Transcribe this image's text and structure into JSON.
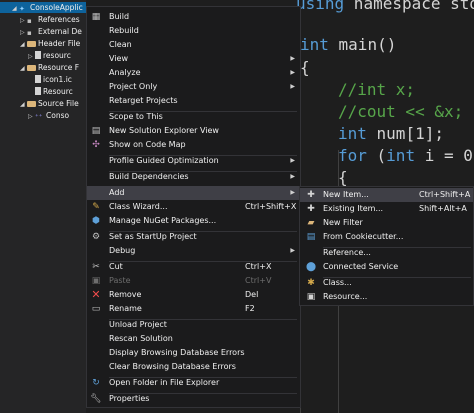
{
  "solution_explorer": {
    "items": [
      {
        "label": "ConsoleApplic",
        "icon": "project-icon",
        "arrow": "◢"
      },
      {
        "label": "References",
        "icon": "references-icon",
        "arrow": "▷"
      },
      {
        "label": "External De",
        "icon": "external-dependencies-icon",
        "arrow": "▷"
      },
      {
        "label": "Header File",
        "icon": "folder-icon",
        "arrow": "◢"
      },
      {
        "label": "resourc",
        "icon": "header-file-icon",
        "arrow": "▷"
      },
      {
        "label": "Resource F",
        "icon": "folder-icon",
        "arrow": "◢"
      },
      {
        "label": "icon1.ic",
        "icon": "icon-file-icon",
        "arrow": ""
      },
      {
        "label": "Resourc",
        "icon": "resource-file-icon",
        "arrow": ""
      },
      {
        "label": "Source File",
        "icon": "folder-icon",
        "arrow": "◢"
      },
      {
        "label": "Conso",
        "icon": "cpp-file-icon",
        "arrow": "▷"
      }
    ]
  },
  "code": {
    "line0": {
      "kw": "using",
      "rest": " namespace std"
    },
    "line1": {
      "kw": "int",
      "rest": " main()"
    },
    "line2": "{",
    "line3": "//int x;",
    "line4": "//cout << &x;",
    "line5": {
      "kw": "int",
      "rest": " num[1];"
    },
    "line6": {
      "kw": "for",
      "mid": " (",
      "kw2": "int",
      "rest": " i = 0"
    },
    "line7": "{"
  },
  "context_menu": {
    "items": [
      {
        "label": "Build",
        "shortcut": "",
        "icon": "build-icon",
        "arrow": false
      },
      {
        "label": "Rebuild",
        "shortcut": "",
        "icon": "",
        "arrow": false
      },
      {
        "label": "Clean",
        "shortcut": "",
        "icon": "",
        "arrow": false
      },
      {
        "label": "View",
        "shortcut": "",
        "icon": "",
        "arrow": true
      },
      {
        "label": "Analyze",
        "shortcut": "",
        "icon": "",
        "arrow": true
      },
      {
        "label": "Project Only",
        "shortcut": "",
        "icon": "",
        "arrow": true
      },
      {
        "label": "Retarget Projects",
        "shortcut": "",
        "icon": "",
        "arrow": false
      },
      {
        "label": "Scope to This",
        "shortcut": "",
        "icon": "",
        "arrow": false
      },
      {
        "label": "New Solution Explorer View",
        "shortcut": "",
        "icon": "solution-explorer-icon",
        "arrow": false
      },
      {
        "label": "Show on Code Map",
        "shortcut": "",
        "icon": "code-map-icon",
        "arrow": false
      },
      {
        "label": "Profile Guided Optimization",
        "shortcut": "",
        "icon": "",
        "arrow": true
      },
      {
        "label": "Build Dependencies",
        "shortcut": "",
        "icon": "",
        "arrow": true
      },
      {
        "label": "Add",
        "shortcut": "",
        "icon": "",
        "arrow": true
      },
      {
        "label": "Class Wizard...",
        "shortcut": "Ctrl+Shift+X",
        "icon": "class-wizard-icon",
        "arrow": false
      },
      {
        "label": "Manage NuGet Packages...",
        "shortcut": "",
        "icon": "nuget-icon",
        "arrow": false
      },
      {
        "label": "Set as StartUp Project",
        "shortcut": "",
        "icon": "gear-icon",
        "arrow": false
      },
      {
        "label": "Debug",
        "shortcut": "",
        "icon": "",
        "arrow": true
      },
      {
        "label": "Cut",
        "shortcut": "Ctrl+X",
        "icon": "cut-icon",
        "arrow": false
      },
      {
        "label": "Paste",
        "shortcut": "Ctrl+V",
        "icon": "paste-icon",
        "arrow": false,
        "disabled": true
      },
      {
        "label": "Remove",
        "shortcut": "Del",
        "icon": "remove-icon",
        "arrow": false
      },
      {
        "label": "Rename",
        "shortcut": "F2",
        "icon": "rename-icon",
        "arrow": false
      },
      {
        "label": "Unload Project",
        "shortcut": "",
        "icon": "",
        "arrow": false
      },
      {
        "label": "Rescan Solution",
        "shortcut": "",
        "icon": "",
        "arrow": false
      },
      {
        "label": "Display Browsing Database Errors",
        "shortcut": "",
        "icon": "",
        "arrow": false
      },
      {
        "label": "Clear Browsing Database Errors",
        "shortcut": "",
        "icon": "",
        "arrow": false
      },
      {
        "label": "Open Folder in File Explorer",
        "shortcut": "",
        "icon": "refresh-folder-icon",
        "arrow": false
      },
      {
        "label": "Properties",
        "shortcut": "",
        "icon": "wrench-icon",
        "arrow": false
      }
    ]
  },
  "add_submenu": {
    "items": [
      {
        "label": "New Item...",
        "shortcut": "Ctrl+Shift+A",
        "icon": "new-item-icon"
      },
      {
        "label": "Existing Item...",
        "shortcut": "Shift+Alt+A",
        "icon": "existing-item-icon"
      },
      {
        "label": "New Filter",
        "shortcut": "",
        "icon": "new-filter-icon"
      },
      {
        "label": "From Cookiecutter...",
        "shortcut": "",
        "icon": "cookiecutter-icon"
      },
      {
        "label": "Reference...",
        "shortcut": "",
        "icon": ""
      },
      {
        "label": "Connected Service",
        "shortcut": "",
        "icon": "connected-service-icon"
      },
      {
        "label": "Class...",
        "shortcut": "",
        "icon": "class-icon"
      },
      {
        "label": "Resource...",
        "shortcut": "",
        "icon": "resource-icon"
      }
    ]
  },
  "colors": {
    "selection": "#0e639c",
    "menu_bg": "#1b1b1c",
    "highlight": "#3f3f46",
    "keyword": "#569cd6",
    "comment": "#57a64a"
  }
}
